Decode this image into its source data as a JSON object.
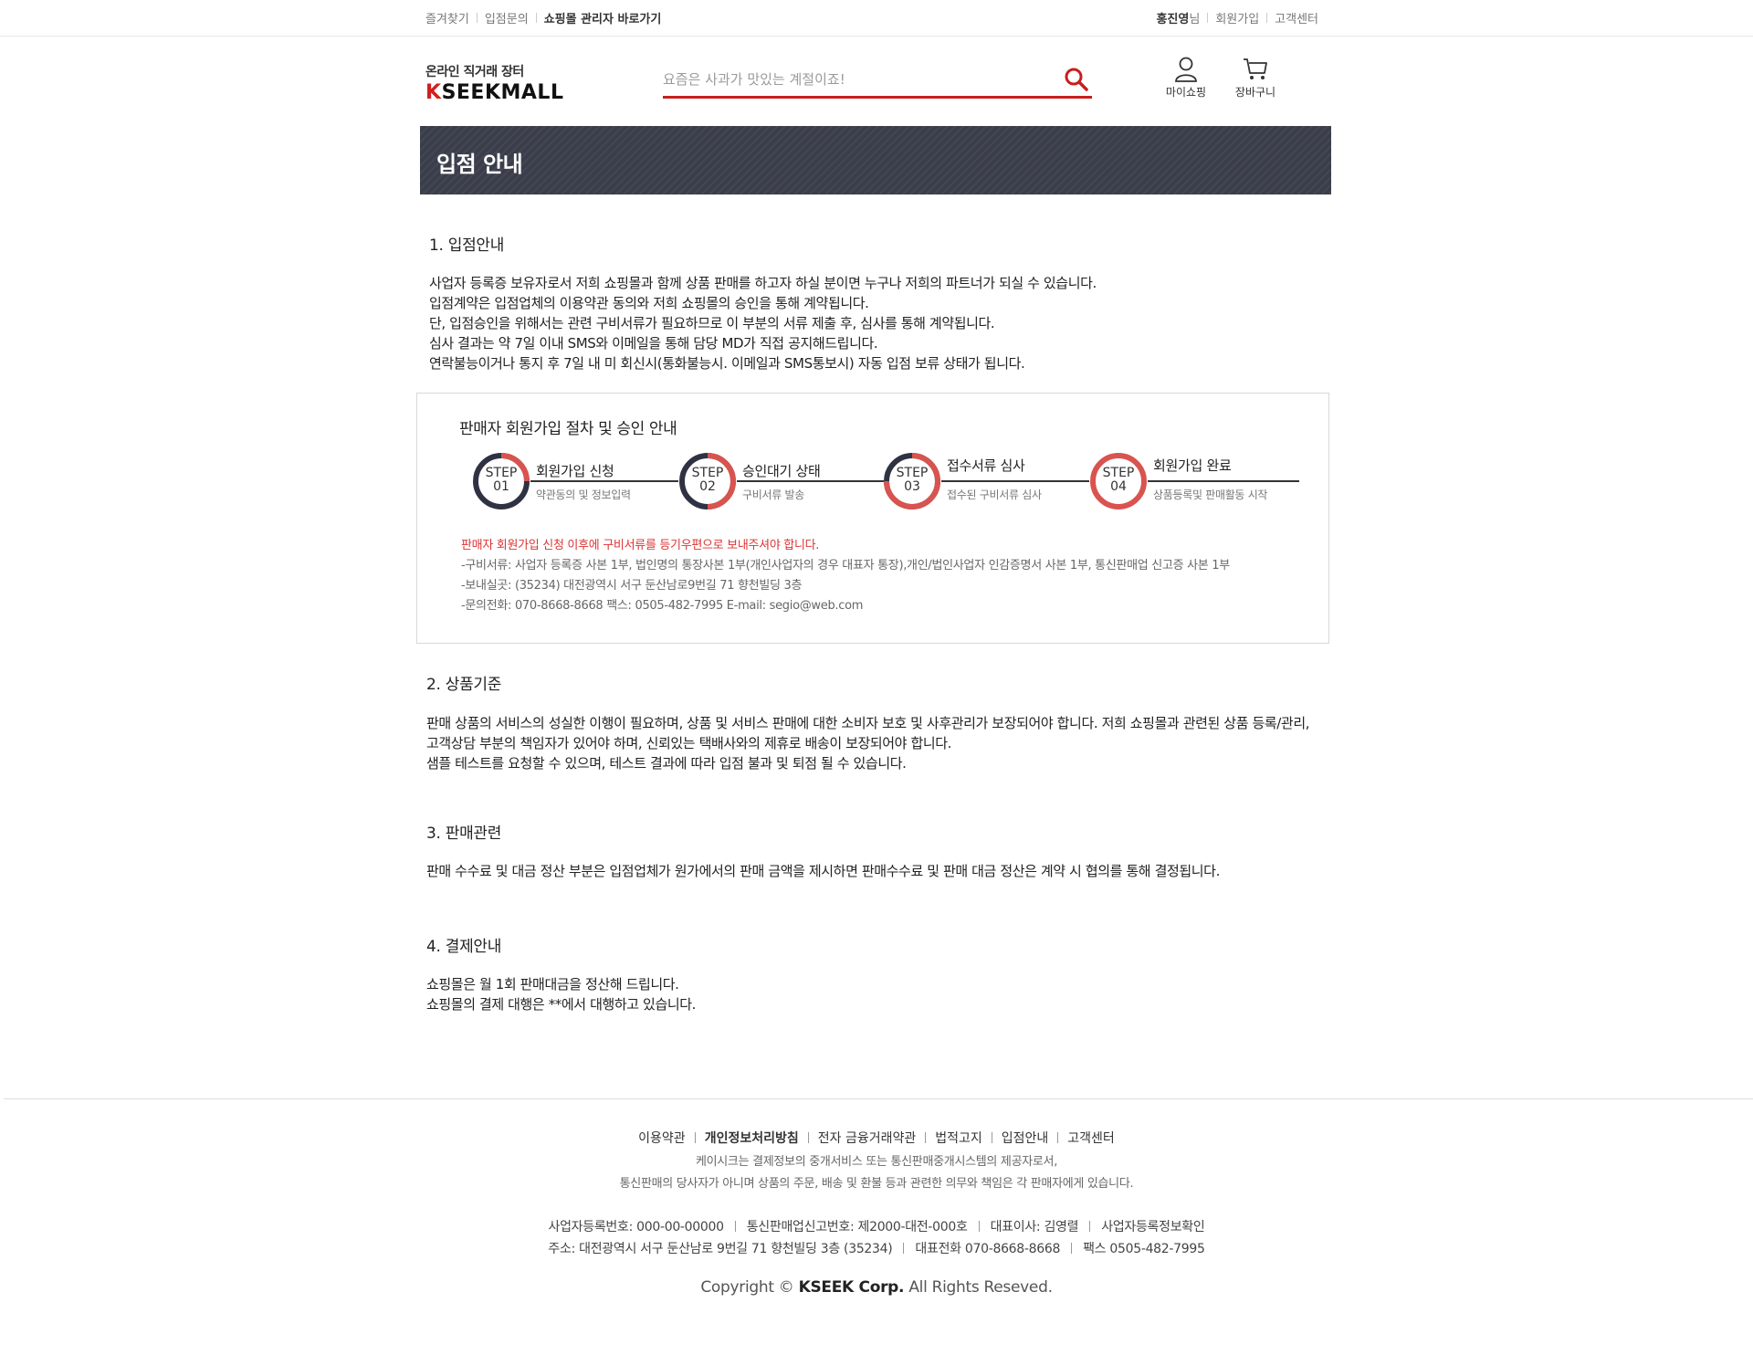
{
  "topbar": {
    "left_links": [
      "즐겨찾기",
      "입점문의",
      "쇼핑몰 관리자 바로가기"
    ],
    "user_name": "홍진영",
    "user_suffix": "님",
    "right_links": [
      "회원가입",
      "고객센터"
    ]
  },
  "header": {
    "logo_tag": "온라인 직거래 장터",
    "logo_first": "K",
    "logo_rest": "SEEKMALL",
    "search_placeholder": "요즘은 사과가 맛있는 계절이죠!",
    "my_shopping": "마이쇼핑",
    "cart": "장바구니"
  },
  "colors": {
    "accent": "#c81e1e",
    "banner": "#3a3d4a",
    "step_red": "#d9534f",
    "step_dark": "#2f3242"
  },
  "banner": {
    "title": "입점 안내"
  },
  "sections": {
    "s1_title": "1. 입점안내",
    "s1_lines": [
      "사업자 등록증 보유자로서 저희 쇼핑몰과 함께 상품  판매를 하고자 하실 분이면 누구나 저희의 파트너가 되실 수 있습니다.",
      "입점계약은 입점업체의 이용약관 동의와 저희 쇼핑몰의 승인을 통해 계약됩니다.",
      "단, 입점승인을 위해서는 관련 구비서류가 필요하므로 이 부분의 서류 제출 후, 심사를 통해 계약됩니다.",
      "심사 결과는 약 7일 이내 SMS와 이메일을 통해 담당 MD가 직접 공지해드립니다.",
      "연락불능이거나 통지 후 7일 내 미 회신시(통화불능시. 이메일과 SMS통보시) 자동 입점 보류 상태가 됩니다."
    ],
    "s2_title": "2. 상품기준",
    "s2_lines": [
      "판매 상품의 서비스의 성실한 이행이 필요하며, 상품 및 서비스 판매에 대한 소비자 보호 및 사후관리가 보장되어야 합니다. 저희 쇼핑몰과 관련된 상품 등록/관리,",
      "고객상담 부분의 책임자가 있어야 하며, 신뢰있는 택배사와의 제휴로 배송이 보장되어야 합니다.",
      "샘플 테스트를 요청할 수 있으며, 테스트 결과에 따라 입점 불과 및 퇴점 될 수 있습니다."
    ],
    "s3_title": "3. 판매관련",
    "s3_lines": [
      "판매 수수료 및 대금 정산 부분은 입점업체가 원가에서의 판매 금액을 제시하면 판매수수료 및 판매 대금 정산은 계약 시 협의를 통해 결정됩니다."
    ],
    "s4_title": "4. 결제안내",
    "s4_lines": [
      "쇼핑몰은 월 1회 판매대금을 정산해 드립니다.",
      "쇼핑몰의 결제 대행은 **에서 대행하고 있습니다."
    ]
  },
  "steps": {
    "title": "판매자 회원가입 절차 및 승인 안내",
    "items": [
      {
        "step": "STEP",
        "num": "01",
        "name": "회원가입 신청",
        "desc": "약관동의 및 정보입력"
      },
      {
        "step": "STEP",
        "num": "02",
        "name": "승인대기 상태",
        "desc": "구비서류 발송"
      },
      {
        "step": "STEP",
        "num": "03",
        "name": "접수서류 심사",
        "desc": "접수된 구비서류 심사"
      },
      {
        "step": "STEP",
        "num": "04",
        "name": "회원가입 완료",
        "desc": "상품등록및 판매활동 시작"
      }
    ],
    "notice": "판매자 회원가입 신청 이후에 구비서류를 등기우편으로 보내주셔야 합니다.",
    "note1": "-구비서류: 사업자 등록증 사본 1부, 법인명의 통장사본 1부(개인사업자의 경우 대표자 통장),개인/법인사업자 인감증명서 사본 1부, 통신판매업 신고증 사본 1부",
    "note2": "-보내실곳: (35234) 대전광역시 서구 둔산남로9번길 71 향천빌딩 3층",
    "note3": "-문의전화: 070-8668-8668  팩스: 0505-482-7995    E-mail: segio@web.com"
  },
  "footer": {
    "links": [
      "이용약관",
      "개인정보처리방침",
      "전자 금융거래약관",
      "법적고지",
      "입점안내",
      "고객센터"
    ],
    "desc1": "케이시크는 결제정보의 중개서비스 또는 통신판매중개시스템의 제공자로서,",
    "desc2": "통신판매의 당사자가 아니며 상품의 주문, 배송 및 환불 등과 관련한 의무와 책임은 각 판매자에게 있습니다.",
    "biz_no": "사업자등록번호: 000-00-00000",
    "mail_order": "통신판매업신고번호:  제2000-대전-000호",
    "ceo": "대표이사: 김영렬",
    "biz_check": "사업자등록정보확인",
    "address": "주소: 대전광역시 서구 둔산남로 9번길 71  향천빌딩 3층  (35234)",
    "phone": "대표전화 070-8668-8668",
    "fax": "팩스  0505-482-7995",
    "copy_pre": "Copyright © ",
    "copy_brand": "KSEEK  Corp.",
    "copy_post": " All Rights Reseved."
  }
}
